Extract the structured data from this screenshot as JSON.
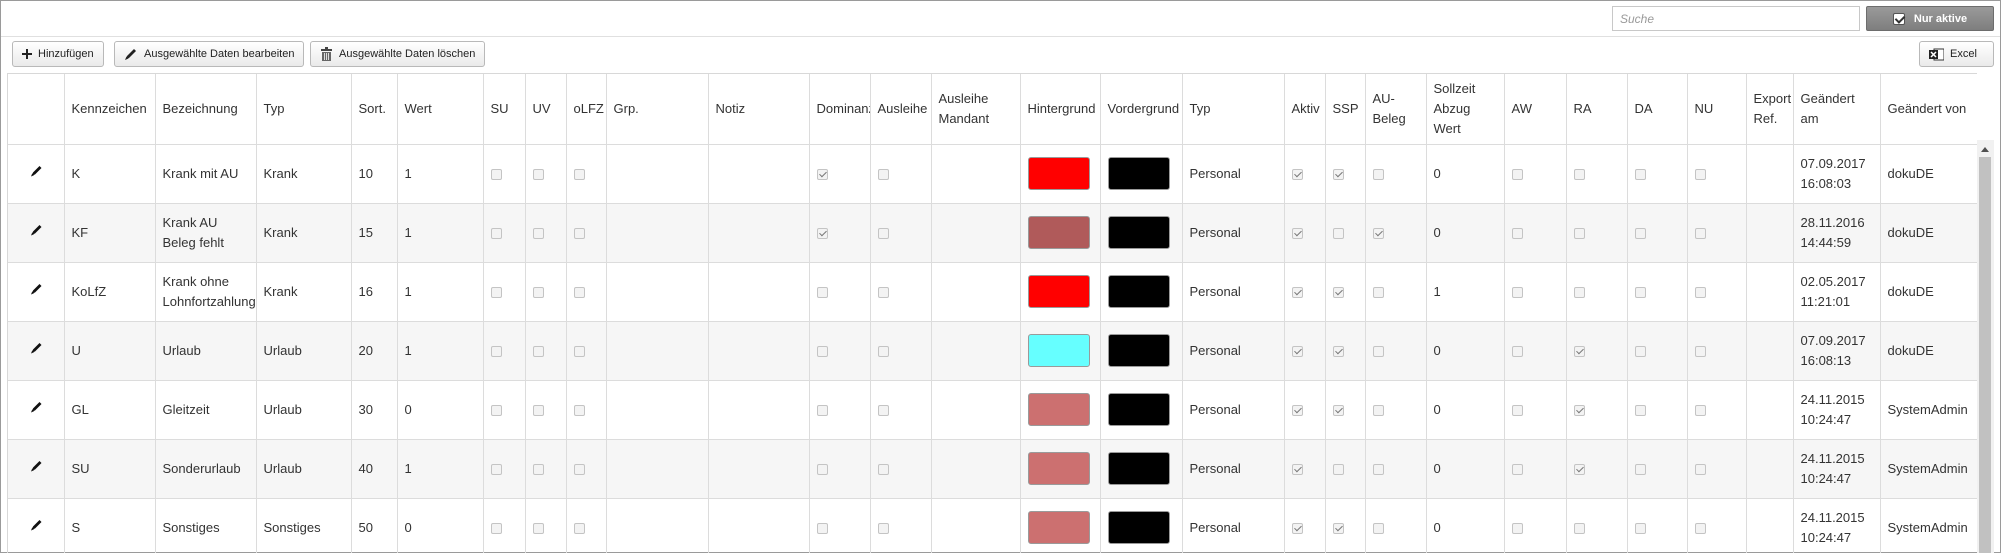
{
  "search": {
    "placeholder": "Suche",
    "value": ""
  },
  "active_filter": {
    "label": "Nur aktive",
    "checked": true
  },
  "toolbar": {
    "add_label": "Hinzufügen",
    "edit_label": "Ausgewählte Daten bearbeiten",
    "delete_label": "Ausgewählte Daten löschen",
    "excel_label": "Excel"
  },
  "table": {
    "headers": [
      "",
      "Kennzeichen",
      "Bezeichnung",
      "Typ",
      "Sort.",
      "Wert",
      "SU",
      "UV",
      "oLFZ",
      "Grp.",
      "Notiz",
      "Dominanz",
      "Ausleihe",
      "Ausleihe Mandant",
      "Hintergrund",
      "Vordergrund",
      "Typ",
      "Aktiv",
      "SSP",
      "AU-Beleg",
      "Sollzeit Abzug Wert",
      "AW",
      "RA",
      "DA",
      "NU",
      "Export Ref.",
      "Geändert am",
      "Geändert von"
    ],
    "rows": [
      {
        "kz": "K",
        "bez": "Krank mit AU",
        "typ": "Krank",
        "sort": "10",
        "wert": "1",
        "su": false,
        "uv": false,
        "olfz": false,
        "grp": "",
        "notiz": "",
        "dom": true,
        "aus": false,
        "ausm": "",
        "bg": "#ff0000",
        "fg": "#000000",
        "typ2": "Personal",
        "aktiv": true,
        "ssp": true,
        "au": false,
        "soll": "0",
        "aw": false,
        "ra": false,
        "da": false,
        "nu": false,
        "exp": "",
        "am": "07.09.2017 16:08:03",
        "von": "dokuDE"
      },
      {
        "kz": "KF",
        "bez": "Krank AU Beleg fehlt",
        "typ": "Krank",
        "sort": "15",
        "wert": "1",
        "su": false,
        "uv": false,
        "olfz": false,
        "grp": "",
        "notiz": "",
        "dom": true,
        "aus": false,
        "ausm": "",
        "bg": "#b05a5a",
        "fg": "#000000",
        "typ2": "Personal",
        "aktiv": true,
        "ssp": false,
        "au": true,
        "soll": "0",
        "aw": false,
        "ra": false,
        "da": false,
        "nu": false,
        "exp": "",
        "am": "28.11.2016 14:44:59",
        "von": "dokuDE"
      },
      {
        "kz": "KoLfZ",
        "bez": "Krank ohne Lohnfortzahlung",
        "typ": "Krank",
        "sort": "16",
        "wert": "1",
        "su": false,
        "uv": false,
        "olfz": false,
        "grp": "",
        "notiz": "",
        "dom": false,
        "aus": false,
        "ausm": "",
        "bg": "#ff0000",
        "fg": "#000000",
        "typ2": "Personal",
        "aktiv": true,
        "ssp": true,
        "au": false,
        "soll": "1",
        "aw": false,
        "ra": false,
        "da": false,
        "nu": false,
        "exp": "",
        "am": "02.05.2017 11:21:01",
        "von": "dokuDE"
      },
      {
        "kz": "U",
        "bez": "Urlaub",
        "typ": "Urlaub",
        "sort": "20",
        "wert": "1",
        "su": false,
        "uv": false,
        "olfz": false,
        "grp": "",
        "notiz": "",
        "dom": false,
        "aus": false,
        "ausm": "",
        "bg": "#66ffff",
        "fg": "#000000",
        "typ2": "Personal",
        "aktiv": true,
        "ssp": true,
        "au": false,
        "soll": "0",
        "aw": false,
        "ra": true,
        "da": false,
        "nu": false,
        "exp": "",
        "am": "07.09.2017 16:08:13",
        "von": "dokuDE"
      },
      {
        "kz": "GL",
        "bez": "Gleitzeit",
        "typ": "Urlaub",
        "sort": "30",
        "wert": "0",
        "su": false,
        "uv": false,
        "olfz": false,
        "grp": "",
        "notiz": "",
        "dom": false,
        "aus": false,
        "ausm": "",
        "bg": "#cc7070",
        "fg": "#000000",
        "typ2": "Personal",
        "aktiv": true,
        "ssp": true,
        "au": false,
        "soll": "0",
        "aw": false,
        "ra": true,
        "da": false,
        "nu": false,
        "exp": "",
        "am": "24.11.2015 10:24:47",
        "von": "SystemAdmin"
      },
      {
        "kz": "SU",
        "bez": "Sonderurlaub",
        "typ": "Urlaub",
        "sort": "40",
        "wert": "1",
        "su": false,
        "uv": false,
        "olfz": false,
        "grp": "",
        "notiz": "",
        "dom": false,
        "aus": false,
        "ausm": "",
        "bg": "#cc7070",
        "fg": "#000000",
        "typ2": "Personal",
        "aktiv": true,
        "ssp": false,
        "au": false,
        "soll": "0",
        "aw": false,
        "ra": true,
        "da": false,
        "nu": false,
        "exp": "",
        "am": "24.11.2015 10:24:47",
        "von": "SystemAdmin"
      },
      {
        "kz": "S",
        "bez": "Sonstiges",
        "typ": "Sonstiges",
        "sort": "50",
        "wert": "0",
        "su": false,
        "uv": false,
        "olfz": false,
        "grp": "",
        "notiz": "",
        "dom": false,
        "aus": false,
        "ausm": "",
        "bg": "#cc7070",
        "fg": "#000000",
        "typ2": "Personal",
        "aktiv": true,
        "ssp": true,
        "au": false,
        "soll": "0",
        "aw": false,
        "ra": false,
        "da": false,
        "nu": false,
        "exp": "",
        "am": "24.11.2015 10:24:47",
        "von": "SystemAdmin"
      }
    ]
  }
}
